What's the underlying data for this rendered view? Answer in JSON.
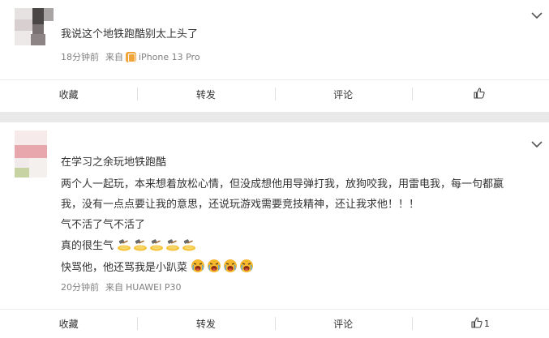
{
  "comments": [
    {
      "text": "我说这个地铁跑酷别太上头了",
      "time": "18分钟前",
      "from_label": "来自",
      "device": "iPhone 13 Pro",
      "actions": {
        "collect": "收藏",
        "repost": "转发",
        "comment": "评论",
        "like_count": ""
      }
    },
    {
      "lines": [
        "在学习之余玩地铁跑酷",
        "两个人一起玩，本来想着放松心情，但没成想他用导弹打我，放狗咬我，用雷电我，每一句都嬴",
        "我，没有一点点要让我的意思，还说玩游戏需要竞技精神，还让我求他！！！",
        "气不活了气不活了",
        "真的很生气",
        "快骂他，他还骂我是小趴菜"
      ],
      "emoji_counts": {
        "angry_hammer": 5,
        "crying": 4
      },
      "time": "20分钟前",
      "from_label": "来自",
      "device": "HUAWEI P30",
      "actions": {
        "collect": "收藏",
        "repost": "转发",
        "comment": "评论",
        "like_count": "1"
      }
    }
  ],
  "icons": {
    "expand": "chevron-down-icon",
    "like": "thumbs-up-icon",
    "device_badge": "weibo-app-badge-icon",
    "emoji_angry": "angry-hammer-emoji-icon",
    "emoji_cry": "crying-emoji-icon"
  },
  "colors": {
    "text": "#333333",
    "meta": "#808080",
    "badge": "#f0a43a",
    "background": "#e9e9e9"
  }
}
